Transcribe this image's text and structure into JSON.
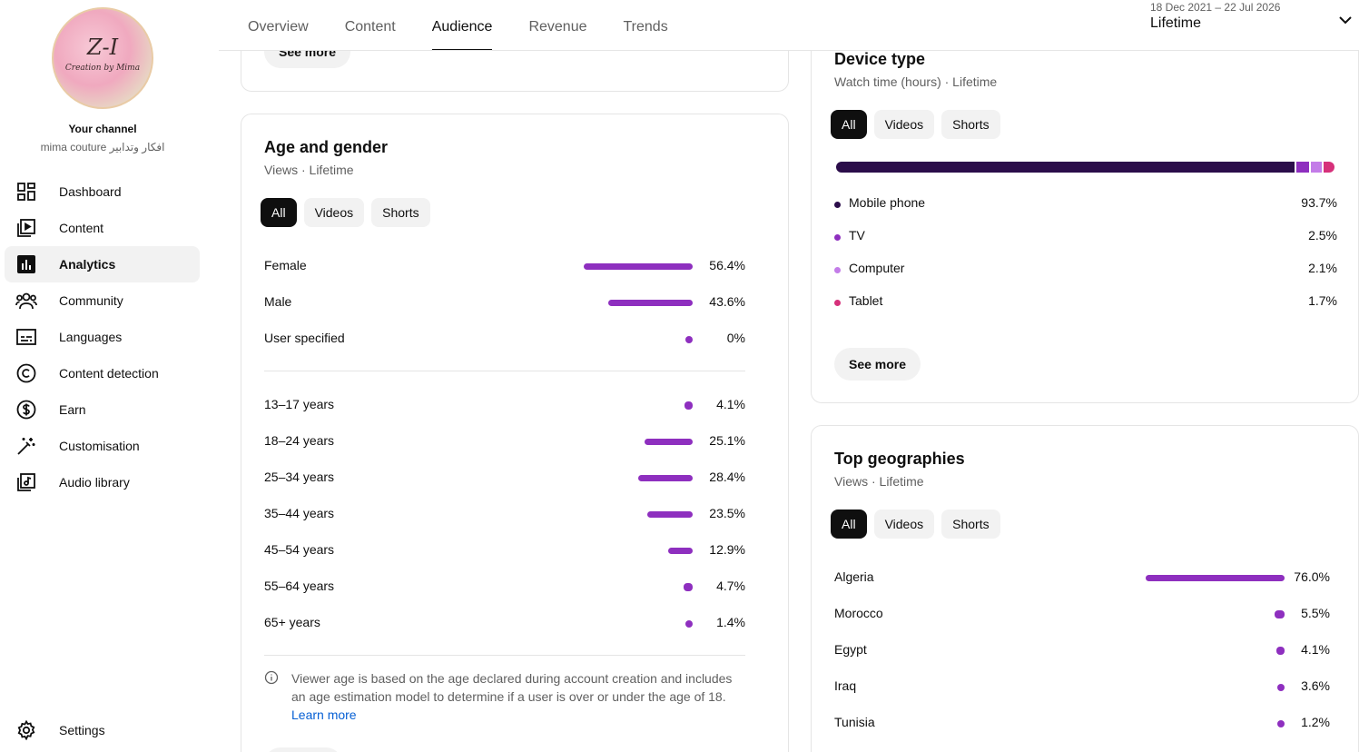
{
  "sidebar": {
    "channel_title": "Your channel",
    "channel_name": "mima couture افكار وتدابير",
    "avatar_text": "Z-I",
    "avatar_sub": "Creation by Mima",
    "items": [
      {
        "label": "Dashboard",
        "icon": "dashboard-icon"
      },
      {
        "label": "Content",
        "icon": "content-icon"
      },
      {
        "label": "Analytics",
        "icon": "analytics-icon"
      },
      {
        "label": "Community",
        "icon": "community-icon"
      },
      {
        "label": "Languages",
        "icon": "languages-icon"
      },
      {
        "label": "Content detection",
        "icon": "copyright-icon"
      },
      {
        "label": "Earn",
        "icon": "dollar-icon"
      },
      {
        "label": "Customisation",
        "icon": "magic-wand-icon"
      },
      {
        "label": "Audio library",
        "icon": "audio-library-icon"
      }
    ],
    "settings_label": "Settings"
  },
  "header": {
    "tabs": [
      "Overview",
      "Content",
      "Audience",
      "Revenue",
      "Trends"
    ],
    "active_tab": "Audience",
    "date_range": "18 Dec 2021 – 22 Jul 2026",
    "period": "Lifetime"
  },
  "top_card": {
    "see_more": "See more"
  },
  "age_gender": {
    "title": "Age and gender",
    "subtitle": "Views · Lifetime",
    "chips": [
      "All",
      "Videos",
      "Shorts"
    ],
    "gender": [
      {
        "label": "Female",
        "value": "56.4%",
        "fraction": 0.564
      },
      {
        "label": "Male",
        "value": "43.6%",
        "fraction": 0.436
      },
      {
        "label": "User specified",
        "value": "0%",
        "fraction": 0
      }
    ],
    "ages": [
      {
        "label": "13–17 years",
        "value": "4.1%",
        "fraction": 0.041
      },
      {
        "label": "18–24 years",
        "value": "25.1%",
        "fraction": 0.251
      },
      {
        "label": "25–34 years",
        "value": "28.4%",
        "fraction": 0.284
      },
      {
        "label": "35–44 years",
        "value": "23.5%",
        "fraction": 0.235
      },
      {
        "label": "45–54 years",
        "value": "12.9%",
        "fraction": 0.129
      },
      {
        "label": "55–64 years",
        "value": "4.7%",
        "fraction": 0.047
      },
      {
        "label": "65+ years",
        "value": "1.4%",
        "fraction": 0.014
      }
    ],
    "note": "Viewer age is based on the age declared during account creation and includes an age estimation model to determine if a user is over or under the age of 18.",
    "learn_more": "Learn more"
  },
  "device_type": {
    "title": "Device type",
    "subtitle": "Watch time (hours) · Lifetime",
    "chips": [
      "All",
      "Videos",
      "Shorts"
    ],
    "items": [
      {
        "label": "Mobile phone",
        "value": "93.7%",
        "fraction": 0.937,
        "color": "#2b0d4a"
      },
      {
        "label": "TV",
        "value": "2.5%",
        "fraction": 0.025,
        "color": "#8e2fbf"
      },
      {
        "label": "Computer",
        "value": "2.1%",
        "fraction": 0.021,
        "color": "#c37ce8"
      },
      {
        "label": "Tablet",
        "value": "1.7%",
        "fraction": 0.017,
        "color": "#d6307a"
      }
    ],
    "see_more": "See more"
  },
  "top_geographies": {
    "title": "Top geographies",
    "subtitle": "Views · Lifetime",
    "chips": [
      "All",
      "Videos",
      "Shorts"
    ],
    "items": [
      {
        "label": "Algeria",
        "value": "76.0%",
        "fraction": 0.76
      },
      {
        "label": "Morocco",
        "value": "5.5%",
        "fraction": 0.055
      },
      {
        "label": "Egypt",
        "value": "4.1%",
        "fraction": 0.041
      },
      {
        "label": "Iraq",
        "value": "3.6%",
        "fraction": 0.036
      },
      {
        "label": "Tunisia",
        "value": "1.2%",
        "fraction": 0.012
      }
    ]
  },
  "colors": {
    "bar": "#8e2fbf",
    "chip_active": "#0f0f0f",
    "link": "#065fd4"
  }
}
